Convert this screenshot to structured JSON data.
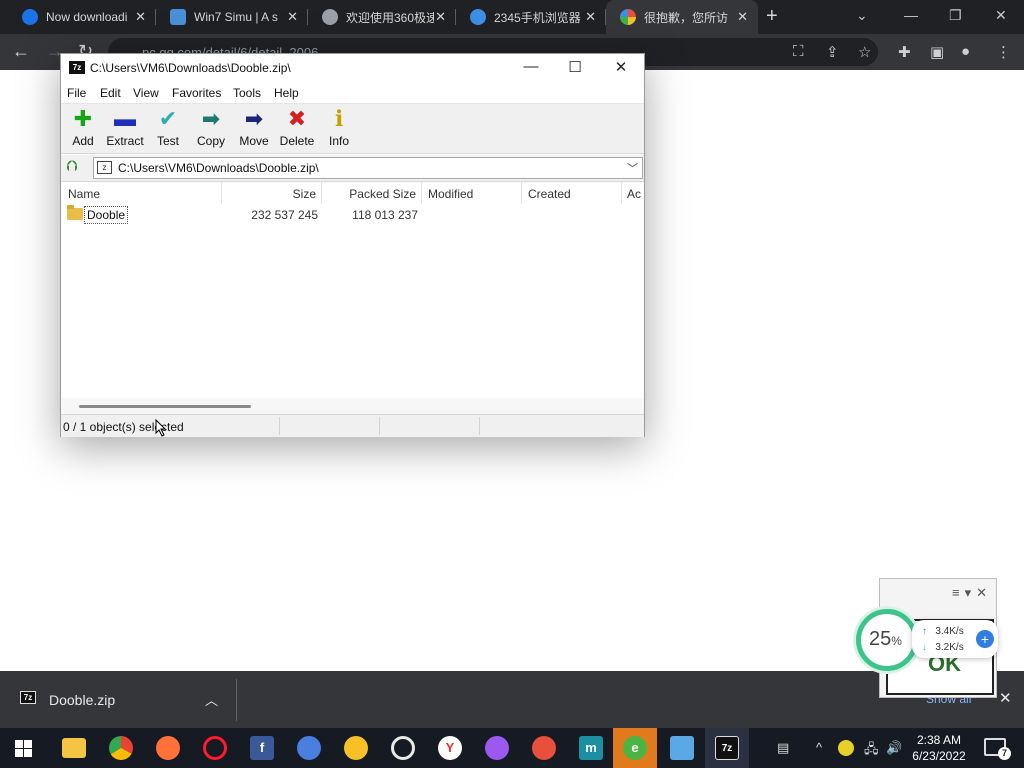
{
  "browser": {
    "tabs": [
      {
        "title": "Now downloadi",
        "color": "#1a73e8"
      },
      {
        "title": "Win7 Simu | A s",
        "color": "#4a90d9"
      },
      {
        "title": "欢迎使用360极速",
        "color": "#9aa0a6"
      },
      {
        "title": "2345手机浏览器",
        "color": "#3e8ee8"
      },
      {
        "title": "很抱歉，您所访",
        "color": "#e84f3d"
      }
    ],
    "new_tab": "+",
    "url": "pc.qq.com/detail/6/detail_2006"
  },
  "sevenzip": {
    "title": "C:\\Users\\VM6\\Downloads\\Dooble.zip\\",
    "logo": "7z",
    "menu": [
      "File",
      "Edit",
      "View",
      "Favorites",
      "Tools",
      "Help"
    ],
    "tools": [
      {
        "label": "Add",
        "icon": "plus-icon",
        "glyph": "✚",
        "color": "#16a516"
      },
      {
        "label": "Extract",
        "icon": "minus-icon",
        "glyph": "▬",
        "color": "#1e2fb8"
      },
      {
        "label": "Test",
        "icon": "check-icon",
        "glyph": "✔",
        "color": "#2ab0b0"
      },
      {
        "label": "Copy",
        "icon": "copy-arrow-icon",
        "glyph": "➡",
        "color": "#1e7a6e"
      },
      {
        "label": "Move",
        "icon": "move-arrow-icon",
        "glyph": "➡",
        "color": "#1e2478"
      },
      {
        "label": "Delete",
        "icon": "delete-x-icon",
        "glyph": "✖",
        "color": "#d42020"
      },
      {
        "label": "Info",
        "icon": "info-icon",
        "glyph": "ℹ",
        "color": "#c7a100"
      }
    ],
    "address": "C:\\Users\\VM6\\Downloads\\Dooble.zip\\",
    "columns": [
      "Name",
      "Size",
      "Packed Size",
      "Modified",
      "Created",
      "Ac"
    ],
    "rows": [
      {
        "name": "Dooble",
        "size": "232 537 245",
        "packed": "118 013 237"
      }
    ],
    "status": "0 / 1 object(s) selected"
  },
  "download_shelf": {
    "file": "Dooble.zip",
    "show_all": "Show all"
  },
  "net_widget": {
    "ok": "OK",
    "percent": "25",
    "percent_unit": "%",
    "up_speed": "3.4K/s",
    "down_speed": "3.2K/s"
  },
  "taskbar": {
    "time": "2:38 AM",
    "date": "6/23/2022",
    "notifications": "7"
  }
}
